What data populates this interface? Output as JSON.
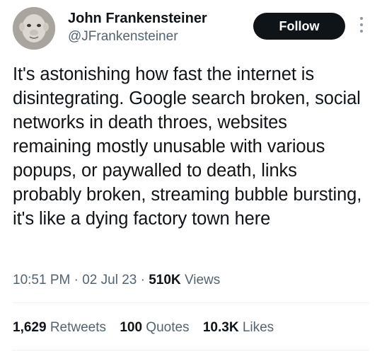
{
  "author": {
    "display_name": "John Frankensteiner",
    "handle": "@JFrankensteiner",
    "avatar": "avatar-photo"
  },
  "follow_button": {
    "label": "Follow"
  },
  "more_menu": {
    "icon": "more-vertical-icon"
  },
  "tweet": {
    "text": "It's astonishing how fast the internet is disintegrating. Google search broken, social networks in death throes, websites remaining mostly unusable with various popups, or paywalled to death, links probably broken, streaming bubble bursting, it's like a dying factory town here",
    "time": "10:51 PM",
    "date": "02 Jul 23",
    "separator": "·",
    "views_count": "510K",
    "views_label": "Views"
  },
  "stats": {
    "retweets_count": "1,629",
    "retweets_label": "Retweets",
    "quotes_count": "100",
    "quotes_label": "Quotes",
    "likes_count": "10.3K",
    "likes_label": "Likes"
  },
  "colors": {
    "text_primary": "#0f1419",
    "text_secondary": "#536471",
    "button_bg": "#0f1419",
    "button_text": "#ffffff",
    "divider": "#eff3f4"
  }
}
